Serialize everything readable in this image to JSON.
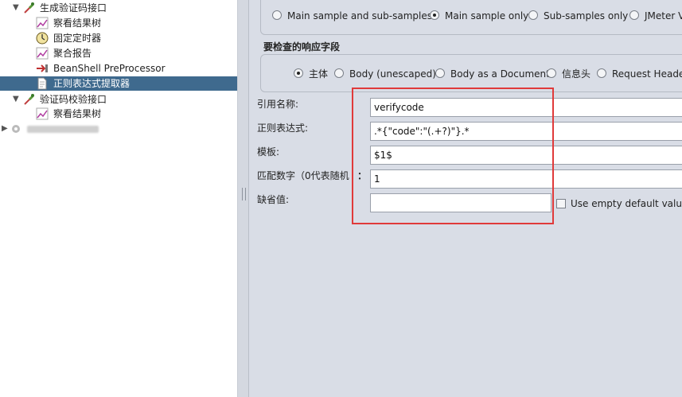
{
  "tree": {
    "items": [
      {
        "label": "生成验证码接口",
        "icon": "dropper-icon",
        "expanded": true
      },
      {
        "label": "察看结果树",
        "icon": "chart-icon"
      },
      {
        "label": "固定定时器",
        "icon": "timer-icon"
      },
      {
        "label": "聚合报告",
        "icon": "chart-icon"
      },
      {
        "label": "BeanShell PreProcessor",
        "icon": "preprocessor-arrow-icon"
      },
      {
        "label": "正则表达式提取器",
        "icon": "document-icon",
        "selected": true
      },
      {
        "label": "验证码校验接口",
        "icon": "dropper-icon",
        "expanded": true
      },
      {
        "label": "察看结果树",
        "icon": "chart-icon"
      }
    ]
  },
  "apply_to": {
    "options": [
      "Main sample and sub-samples",
      "Main sample only",
      "Sub-samples only",
      "JMeter Va"
    ],
    "selected": 1
  },
  "field_to_check": {
    "title": "要检查的响应字段",
    "options": [
      "主体",
      "Body (unescaped)",
      "Body as a Document",
      "信息头",
      "Request Heade"
    ],
    "selected": 0
  },
  "form": {
    "reference_name_label": "引用名称:",
    "reference_name_value": "verifycode",
    "regex_label": "正则表达式:",
    "regex_value": ".*{\"code\":\"(.+?)\"}.*",
    "template_label": "模板:",
    "template_value": "$1$",
    "match_no_label": "匹配数字（0代表随机",
    "match_no_colon": "：",
    "match_no_value": "1",
    "default_label": "缺省值:",
    "default_value": "",
    "use_empty_default_label": "Use empty default value"
  },
  "colors": {
    "selection": "#3f6a8e",
    "highlight_border": "#e03a3a",
    "panel_bg": "#d9dde6"
  }
}
